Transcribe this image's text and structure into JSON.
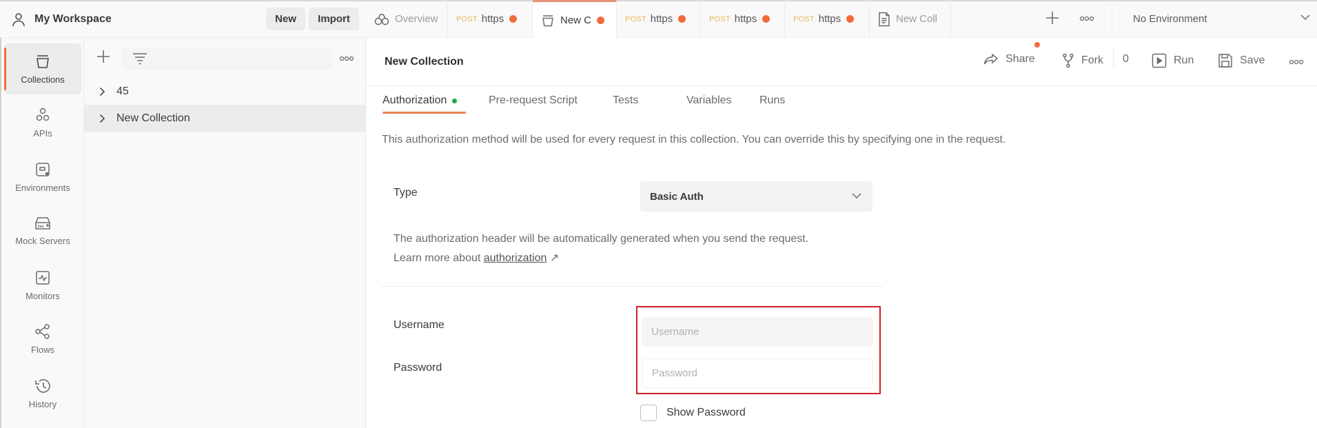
{
  "header": {
    "workspace_name": "My Workspace",
    "new_label": "New",
    "import_label": "Import"
  },
  "tabs": [
    {
      "type": "overview",
      "label": "Overview",
      "active": false,
      "unsaved": false
    },
    {
      "type": "request",
      "method": "POST",
      "label": "https",
      "active": false,
      "unsaved": true
    },
    {
      "type": "collection",
      "label": "New C",
      "active": true,
      "unsaved": true
    },
    {
      "type": "request",
      "method": "POST",
      "label": "https",
      "active": false,
      "unsaved": true
    },
    {
      "type": "request",
      "method": "POST",
      "label": "https",
      "active": false,
      "unsaved": true
    },
    {
      "type": "request",
      "method": "POST",
      "label": "https",
      "active": false,
      "unsaved": true
    },
    {
      "type": "document",
      "label": "New Coll",
      "active": false,
      "unsaved": false
    }
  ],
  "environment": {
    "selected": "No Environment"
  },
  "sidebar": {
    "items": [
      {
        "label": "Collections",
        "icon": "collections-icon",
        "active": true
      },
      {
        "label": "APIs",
        "icon": "apis-icon",
        "active": false
      },
      {
        "label": "Environments",
        "icon": "environments-icon",
        "active": false
      },
      {
        "label": "Mock Servers",
        "icon": "mock-servers-icon",
        "active": false
      },
      {
        "label": "Monitors",
        "icon": "monitors-icon",
        "active": false
      },
      {
        "label": "Flows",
        "icon": "flows-icon",
        "active": false
      },
      {
        "label": "History",
        "icon": "history-icon",
        "active": false
      }
    ]
  },
  "collections": {
    "search_placeholder": "",
    "items": [
      {
        "name": "45",
        "selected": false
      },
      {
        "name": "New Collection",
        "selected": true
      }
    ]
  },
  "main": {
    "title": "New Collection",
    "actions": {
      "share": "Share",
      "fork": "Fork",
      "fork_count": "0",
      "run": "Run",
      "save": "Save"
    },
    "subtabs": [
      {
        "label": "Authorization",
        "active": true,
        "indicator": true
      },
      {
        "label": "Pre-request Script",
        "active": false
      },
      {
        "label": "Tests",
        "active": false
      },
      {
        "label": "Variables",
        "active": false
      },
      {
        "label": "Runs",
        "active": false
      }
    ],
    "description": "This authorization method will be used for every request in this collection. You can override this by specifying one in the request.",
    "auth": {
      "type_label": "Type",
      "type_value": "Basic Auth",
      "help_text_1": "The authorization header will be automatically generated when you send the request. Learn more about ",
      "help_link": "authorization",
      "help_arrow": "↗",
      "username_label": "Username",
      "username_placeholder": "Username",
      "username_value": "",
      "password_label": "Password",
      "password_placeholder": "Password",
      "password_value": "",
      "show_password_label": "Show Password",
      "show_password_checked": false
    }
  },
  "colors": {
    "accent": "#f26b3a",
    "active_indicator": "#22a84a",
    "method_post": "#e8b55a",
    "highlight_box": "#cc1f24"
  }
}
